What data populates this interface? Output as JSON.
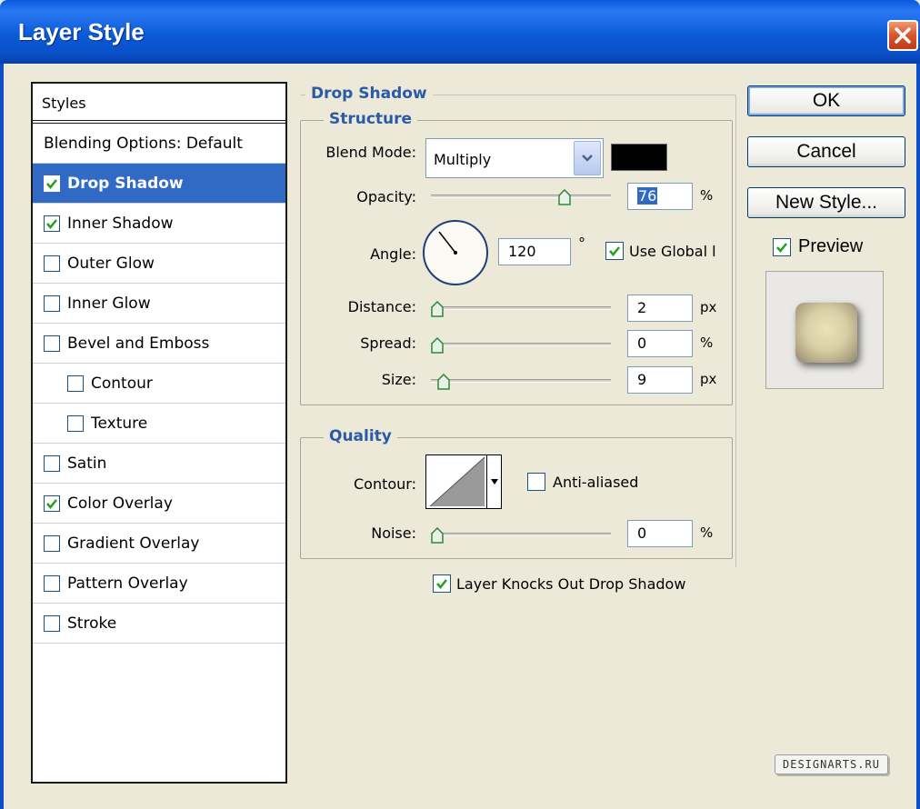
{
  "window": {
    "title": "Layer Style"
  },
  "styles": {
    "header": "Styles",
    "items": [
      {
        "label": "Blending Options: Default",
        "checkbox": false,
        "checked": false,
        "selected": false,
        "indent": false
      },
      {
        "label": "Drop Shadow",
        "checkbox": true,
        "checked": true,
        "selected": true,
        "indent": false
      },
      {
        "label": "Inner Shadow",
        "checkbox": true,
        "checked": true,
        "selected": false,
        "indent": false
      },
      {
        "label": "Outer Glow",
        "checkbox": true,
        "checked": false,
        "selected": false,
        "indent": false
      },
      {
        "label": "Inner Glow",
        "checkbox": true,
        "checked": false,
        "selected": false,
        "indent": false
      },
      {
        "label": "Bevel and Emboss",
        "checkbox": true,
        "checked": false,
        "selected": false,
        "indent": false
      },
      {
        "label": "Contour",
        "checkbox": true,
        "checked": false,
        "selected": false,
        "indent": true
      },
      {
        "label": "Texture",
        "checkbox": true,
        "checked": false,
        "selected": false,
        "indent": true
      },
      {
        "label": "Satin",
        "checkbox": true,
        "checked": false,
        "selected": false,
        "indent": false
      },
      {
        "label": "Color Overlay",
        "checkbox": true,
        "checked": true,
        "selected": false,
        "indent": false
      },
      {
        "label": "Gradient Overlay",
        "checkbox": true,
        "checked": false,
        "selected": false,
        "indent": false
      },
      {
        "label": "Pattern Overlay",
        "checkbox": true,
        "checked": false,
        "selected": false,
        "indent": false
      },
      {
        "label": "Stroke",
        "checkbox": true,
        "checked": false,
        "selected": false,
        "indent": false
      }
    ]
  },
  "drop_shadow": {
    "section_title": "Drop Shadow",
    "structure": {
      "title": "Structure",
      "blend_mode_label": "Blend Mode:",
      "blend_mode_value": "Multiply",
      "shadow_color": "#000000",
      "opacity_label": "Opacity:",
      "opacity_value": "76",
      "opacity_unit": "%",
      "opacity_slider": 0.76,
      "angle_label": "Angle:",
      "angle_value": "120",
      "angle_unit": "°",
      "use_global_light_label": "Use Global l",
      "use_global_light_checked": true,
      "distance_label": "Distance:",
      "distance_value": "2",
      "distance_unit": "px",
      "distance_slider": 0.0,
      "spread_label": "Spread:",
      "spread_value": "0",
      "spread_unit": "%",
      "spread_slider": 0.0,
      "size_label": "Size:",
      "size_value": "9",
      "size_unit": "px",
      "size_slider": 0.04
    },
    "quality": {
      "title": "Quality",
      "contour_label": "Contour:",
      "anti_aliased_label": "Anti-aliased",
      "anti_aliased_checked": false,
      "noise_label": "Noise:",
      "noise_value": "0",
      "noise_unit": "%",
      "noise_slider": 0.0
    },
    "knockout_label": "Layer Knocks Out Drop Shadow",
    "knockout_checked": true
  },
  "buttons": {
    "ok": "OK",
    "cancel": "Cancel",
    "new_style": "New Style..."
  },
  "preview": {
    "label": "Preview",
    "checked": true
  },
  "watermark": "DESIGNARTS.RU",
  "colors": {
    "title_bar": "#0a5ae0",
    "selection": "#316ac5",
    "group_title": "#2b5aa8",
    "dialog_bg": "#ece9d8"
  }
}
